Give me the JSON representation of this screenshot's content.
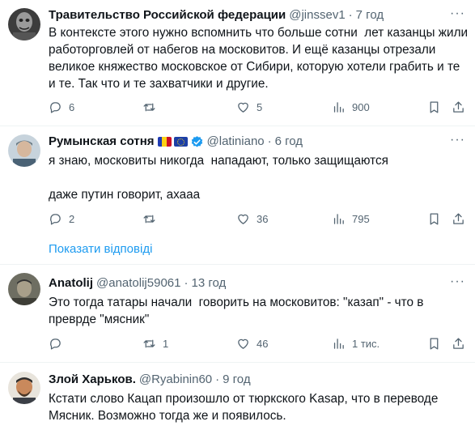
{
  "tweets": [
    {
      "name": "Травительство Российской федерации",
      "handle": "@jinssev1",
      "time": "7 год",
      "text": "В контексте этого нужно вспомнить что больше сотни  лет казанцы жили работорговлей от набегов на московитов. И ещё казанцы отрезали великое княжество московское от Сибири, которую хотели грабить и те и те. Так что и те захватчики и другие.",
      "replies": "6",
      "retweets": "",
      "likes": "5",
      "views": "900"
    },
    {
      "name": "Румынская сотня",
      "handle": "@latiniano",
      "time": "6 год",
      "text": "я знаю, московиты никогда  нападают, только защищаются\n\nдаже путин говорит, ахааа",
      "replies": "2",
      "retweets": "",
      "likes": "36",
      "views": "795"
    },
    {
      "name": "Anatolij",
      "handle": "@anatolij59061",
      "time": "13 год",
      "text": "Это тогда татары начали  говорить на московитов: \"казап\" - что в преврде \"мясник\"",
      "replies": "",
      "retweets": "1",
      "likes": "46",
      "views": "1 тис."
    },
    {
      "name": "Злой Харьков.",
      "handle": "@Ryabinin60",
      "time": "9 год",
      "text": "Кстати слово Кацап произошло от тюркского Kasap, что в переводе Мясник. Возможно тогда же и появилось."
    }
  ],
  "show_replies_label": "Показати відповіді",
  "separator": "·",
  "more_glyph": "···",
  "colors": {
    "accent": "#1d9bf0",
    "muted": "#536471",
    "text": "#0f1419",
    "divider": "#eff3f4"
  },
  "icons": [
    "reply-icon",
    "retweet-icon",
    "like-icon",
    "views-icon",
    "bookmark-icon",
    "share-icon",
    "verified-badge-icon",
    "more-icon",
    "flag-romania-icon",
    "flag-eu-icon"
  ]
}
